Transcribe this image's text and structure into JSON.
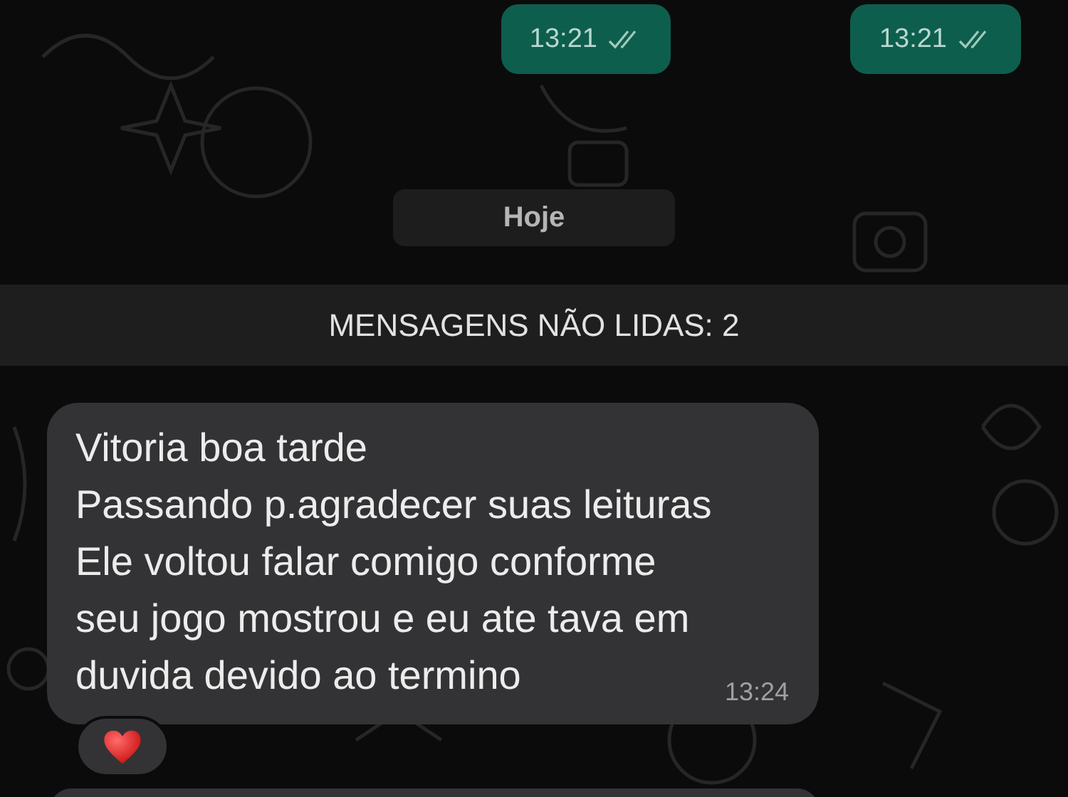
{
  "outgoing": [
    {
      "time": "13:21",
      "read": true
    },
    {
      "time": "13:21",
      "read": true
    }
  ],
  "date_divider": "Hoje",
  "unread_banner": "MENSAGENS NÃO LIDAS: 2",
  "incoming": [
    {
      "lines": [
        "Vitoria boa tarde",
        "Passando p.agradecer suas leituras",
        "Ele voltou falar comigo conforme",
        "seu jogo mostrou e eu ate tava em",
        "duvida devido ao termino"
      ],
      "time": "13:24",
      "reactions": [
        {
          "kind": "heart"
        }
      ]
    },
    {
      "kind": "cut"
    }
  ]
}
